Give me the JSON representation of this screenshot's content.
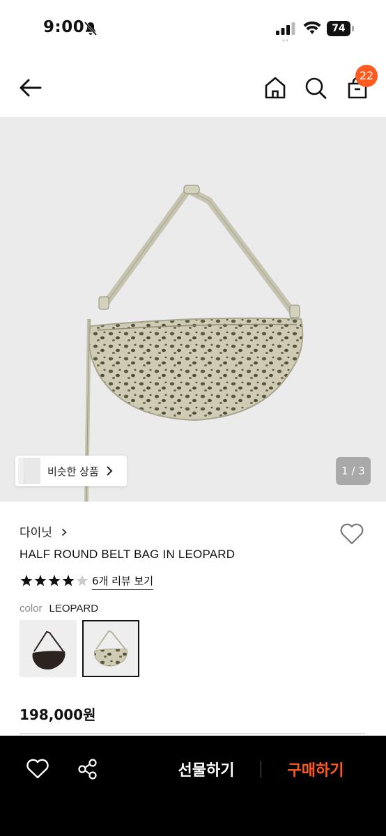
{
  "status_bar": {
    "time": "9:00",
    "battery": "74",
    "icons": [
      "bell-slash-icon",
      "signal-icon",
      "wifi-icon",
      "battery-icon"
    ]
  },
  "header": {
    "icons": [
      "back-arrow-icon",
      "home-icon",
      "search-icon",
      "shopping-bag-icon"
    ],
    "cart_count": "22",
    "accent_color": "#ff5a1f"
  },
  "gallery": {
    "similar_label": "비슷한 상품",
    "page_indicator": "1 / 3"
  },
  "product": {
    "brand": "다이닛",
    "name": "HALF ROUND BELT BAG IN LEOPARD",
    "rating": 4,
    "rating_max": 5,
    "review_link": "6개 리뷰 보기",
    "color_key": "color",
    "color_value": "LEOPARD",
    "price": "198,000원"
  },
  "bottom_bar": {
    "gift_label": "선물하기",
    "buy_label": "구매하기",
    "buy_color": "#ff5a1f"
  }
}
